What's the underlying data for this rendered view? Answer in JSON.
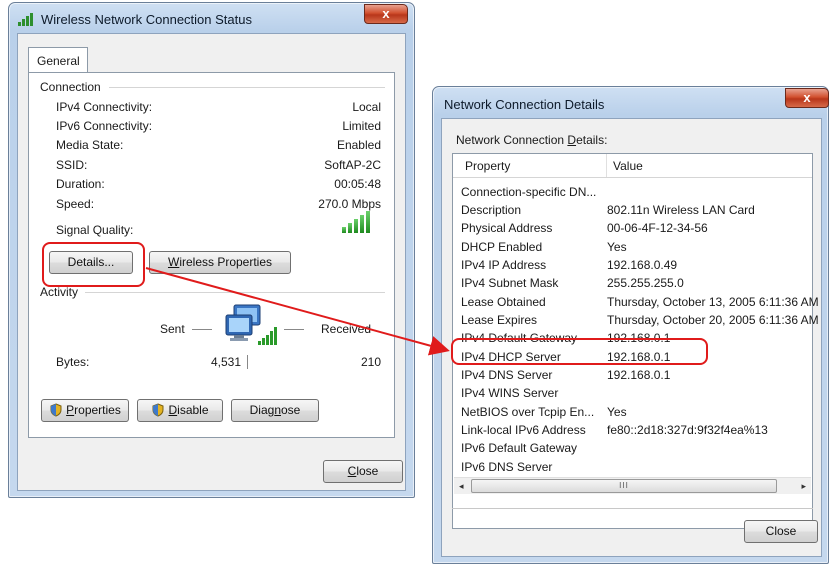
{
  "status_window": {
    "title": "Wireless Network Connection Status",
    "close_glyph": "x",
    "tab": "General",
    "connection": {
      "group_label": "Connection",
      "rows": [
        {
          "label": "IPv4 Connectivity:",
          "value": "Local"
        },
        {
          "label": "IPv6 Connectivity:",
          "value": "Limited"
        },
        {
          "label": "Media State:",
          "value": "Enabled"
        },
        {
          "label": "SSID:",
          "value": "SoftAP-2C"
        },
        {
          "label": "Duration:",
          "value": "00:05:48"
        },
        {
          "label": "Speed:",
          "value": "270.0 Mbps"
        }
      ],
      "signal_label": "Signal Quality:",
      "signal_icon": "signal-bars-icon",
      "details_button": "Details...",
      "wireless_properties_button_prefix": "W",
      "wireless_properties_button_rest": "ireless Properties"
    },
    "activity": {
      "group_label": "Activity",
      "sent_label": "Sent",
      "received_label": "Received",
      "bytes_label": "Bytes:",
      "bytes_sent": "4,531",
      "bytes_received": "210",
      "network_icon": "network-computers-icon"
    },
    "buttons": {
      "properties_prefix": "P",
      "properties_rest": "roperties",
      "disable_prefix": "D",
      "disable_rest": "isable",
      "diagnose_pre": "Diag",
      "diagnose_u": "n",
      "diagnose_post": "ose",
      "close_prefix": "C",
      "close_rest": "lose"
    }
  },
  "details_window": {
    "title": "Network Connection Details",
    "close_glyph": "x",
    "caption_pre": "Network Connection ",
    "caption_u": "D",
    "caption_post": "etails:",
    "columns": [
      "Property",
      "Value"
    ],
    "rows": [
      {
        "property": "Connection-specific DN...",
        "value": ""
      },
      {
        "property": "Description",
        "value": "802.11n Wireless LAN Card"
      },
      {
        "property": "Physical Address",
        "value": "00-06-4F-12-34-56"
      },
      {
        "property": "DHCP Enabled",
        "value": "Yes"
      },
      {
        "property": "IPv4 IP Address",
        "value": "192.168.0.49"
      },
      {
        "property": "IPv4 Subnet Mask",
        "value": "255.255.255.0"
      },
      {
        "property": "Lease Obtained",
        "value": "Thursday, October 13, 2005 6:11:36 AM"
      },
      {
        "property": "Lease Expires",
        "value": "Thursday, October 20, 2005 6:11:36 AM"
      },
      {
        "property": "IPv4 Default Gateway",
        "value": "192.168.0.1"
      },
      {
        "property": "IPv4 DHCP Server",
        "value": "192.168.0.1"
      },
      {
        "property": "IPv4 DNS Server",
        "value": "192.168.0.1"
      },
      {
        "property": "IPv4 WINS Server",
        "value": ""
      },
      {
        "property": "NetBIOS over Tcpip En...",
        "value": "Yes"
      },
      {
        "property": "Link-local IPv6 Address",
        "value": "fe80::2d18:327d:9f32f4ea%13"
      },
      {
        "property": "IPv6 Default Gateway",
        "value": ""
      },
      {
        "property": "IPv6 DNS Server",
        "value": ""
      }
    ],
    "scroll_left": "◂",
    "scroll_right": "▸",
    "scroll_thumb_grip": "III",
    "close_button": "Close"
  },
  "annotation": {
    "color": "#e01b1b",
    "highlighted_button": "Details...",
    "highlighted_row": "IPv4 DHCP Server"
  }
}
